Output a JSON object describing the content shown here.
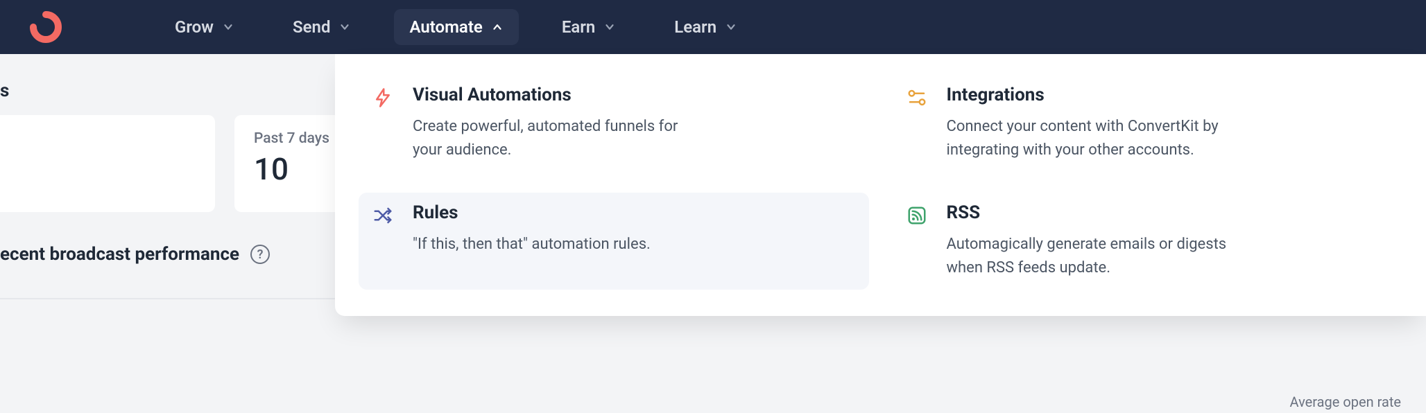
{
  "nav": {
    "items": [
      {
        "label": "Grow"
      },
      {
        "label": "Send"
      },
      {
        "label": "Automate"
      },
      {
        "label": "Earn"
      },
      {
        "label": "Learn"
      }
    ]
  },
  "dashboard": {
    "subscribers_label": "s",
    "stat": {
      "period": "Past 7 days",
      "value": "10"
    },
    "section_title": "ecent broadcast performance",
    "avg_open_label": "Average open rate"
  },
  "dropdown": {
    "items": [
      {
        "title": "Visual Automations",
        "desc": "Create powerful, automated funnels for your audience."
      },
      {
        "title": "Integrations",
        "desc": "Connect your content with ConvertKit by integrating with your other accounts."
      },
      {
        "title": "Rules",
        "desc": "\"If this, then that\" automation rules."
      },
      {
        "title": "RSS",
        "desc": "Automagically generate emails or digests when RSS feeds update."
      }
    ]
  },
  "colors": {
    "navbar": "#1f2a44",
    "accent_red": "#f36a63",
    "accent_amber": "#e8a33d",
    "accent_indigo": "#4e5ba6",
    "accent_green": "#3fa36c"
  }
}
